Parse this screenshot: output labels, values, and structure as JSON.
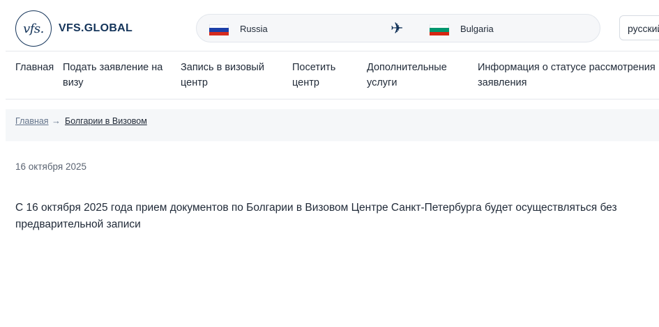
{
  "header": {
    "logo_mark": "vfs.",
    "logo_text": "VFS.GLOBAL",
    "route": {
      "from": "Russia",
      "to": "Bulgaria"
    },
    "language": "русский"
  },
  "nav": [
    {
      "label": "Главная"
    },
    {
      "label": "Подать заявление на визу"
    },
    {
      "label": "Запись в визовый центр"
    },
    {
      "label": "Посетить центр"
    },
    {
      "label": "Дополнительные услуги"
    },
    {
      "label": "Информация о статусе рассмотрения вашего заявления"
    }
  ],
  "breadcrumb": {
    "home": "Главная",
    "separator": "→",
    "current": "Болгарии в Визовом"
  },
  "article": {
    "date": "16 октября 2025",
    "body": "С 16 октября 2025 года прием документов по Болгарии в Визовом Центре Санкт-Петербурга будет осуществляться без предварительной записи"
  },
  "colors": {
    "brand": "#14345a",
    "breadcrumb_bg": "#f5f7f9",
    "route_bg": "#f6f7f9"
  },
  "icons": {
    "plane": "airplane-icon",
    "flag_from": "russia-flag-icon",
    "flag_to": "bulgaria-flag-icon"
  }
}
